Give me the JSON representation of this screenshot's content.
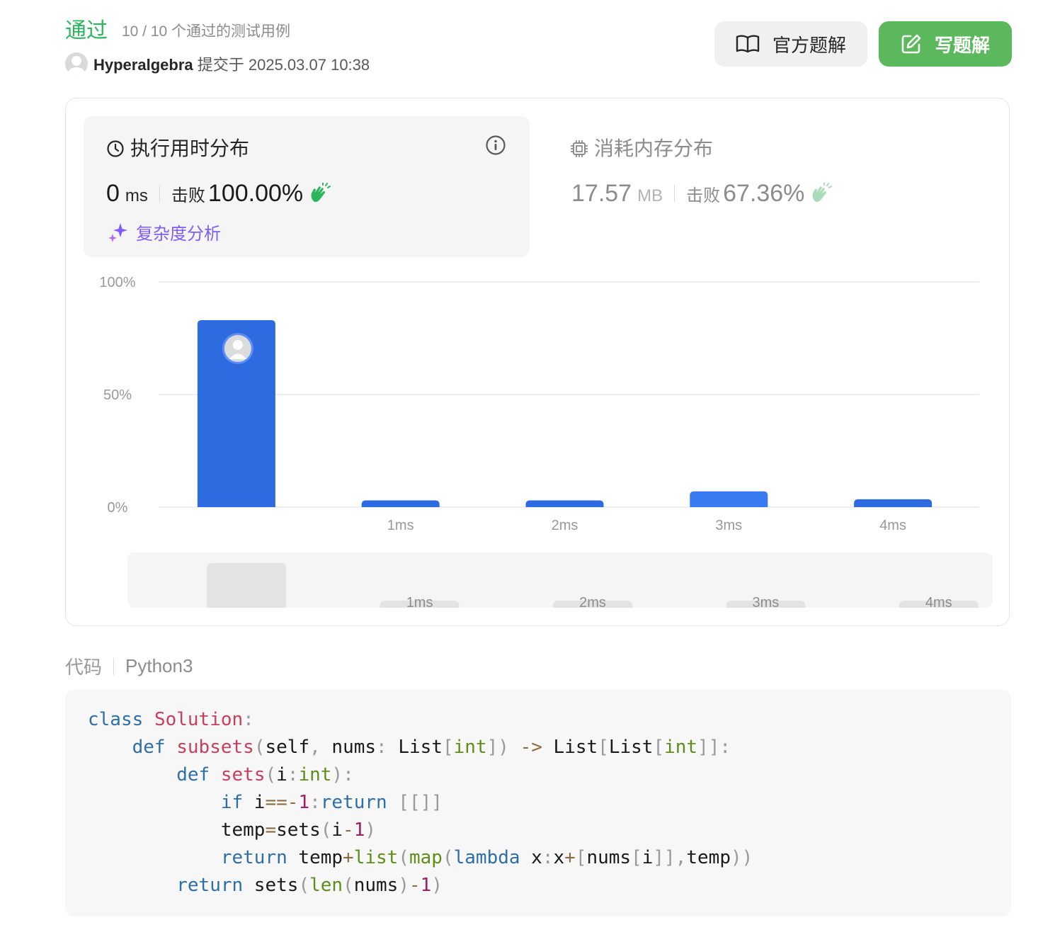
{
  "header": {
    "status": "通过",
    "test_summary": "10 / 10 个通过的测试用例",
    "username": "Hyperalgebra",
    "submitted_at": "提交于 2025.03.07 10:38",
    "official_solution_label": "官方题解",
    "write_solution_label": "写题解"
  },
  "runtime": {
    "title": "执行用时分布",
    "value": "0",
    "unit": "ms",
    "beat_label": "击败",
    "beat_percent": "100.00%",
    "analysis_label": "复杂度分析"
  },
  "memory": {
    "title": "消耗内存分布",
    "value": "17.57",
    "unit": "MB",
    "beat_label": "击败",
    "beat_percent": "67.36%"
  },
  "chart_data": {
    "type": "bar",
    "categories": [
      "",
      "1ms",
      "2ms",
      "3ms",
      "4ms"
    ],
    "values": [
      83,
      3,
      3,
      7,
      3.5
    ],
    "ylim": [
      0,
      100
    ],
    "yticks": [
      "100%",
      "50%",
      "0%"
    ],
    "highlight_index": 0,
    "colors": {
      "bar": "#2f6be0",
      "bar_light": "#3a7af0",
      "grid": "#e8e8e8",
      "mini_bar": "#e3e3e3"
    },
    "minimap_labels": [
      "",
      "1ms",
      "2ms",
      "3ms",
      "4ms"
    ]
  },
  "code": {
    "label": "代码",
    "language": "Python3"
  },
  "colors": {
    "accepted": "#2db55d",
    "write_button": "#5cb85c",
    "analysis": "#7f5cff"
  }
}
